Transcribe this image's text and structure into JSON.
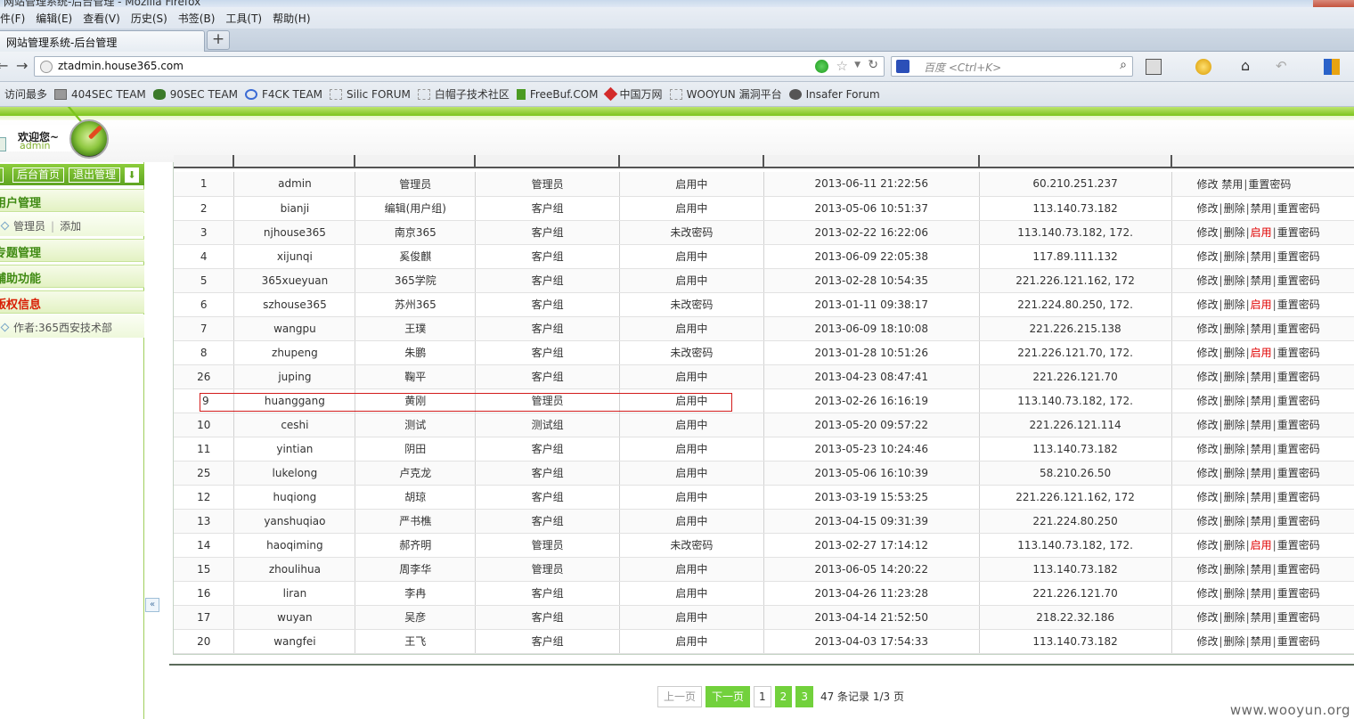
{
  "window": {
    "title": "网站管理系统-后台管理 - Mozilla Firefox",
    "colors": {
      "accent_green": "#72d13c",
      "header_green": "#7cc41d",
      "alert_red": "#e00000",
      "highlight_red": "#d21b1b"
    }
  },
  "browser": {
    "menu": [
      "件(F)",
      "编辑(E)",
      "查看(V)",
      "历史(S)",
      "书签(B)",
      "工具(T)",
      "帮助(H)"
    ],
    "tab_title": "网站管理系统-后台管理",
    "new_tab": "+",
    "url": "ztadmin.house365.com",
    "search_placeholder": "百度 <Ctrl+K>",
    "bookmarks": [
      "访问最多",
      "404SEC TEAM",
      "90SEC TEAM",
      "F4CK TEAM",
      "Silic FORUM",
      "白帽子技术社区",
      "FreeBuf.COM",
      "中国万网",
      "WOOYUN 漏洞平台",
      "Insafer Forum"
    ]
  },
  "header": {
    "welcome": "欢迎您~",
    "username": "admin"
  },
  "sidebar": {
    "home_btn": "后台首页",
    "logout_btn": "退出管理",
    "sections": {
      "user_mgmt": "用户管理",
      "admin_link": "管理员",
      "add_link": "添加",
      "topic_mgmt": "专题管理",
      "aux": "辅助功能",
      "copyright": "版权信息",
      "author": "作者:365西安技术部"
    },
    "collapse": "«"
  },
  "table": {
    "ops": {
      "edit": "修改",
      "delete": "删除",
      "disable": "禁用",
      "enable": "启用",
      "reset": "重置密码"
    },
    "rows": [
      {
        "id": "1",
        "user": "admin",
        "name": "管理员",
        "type": "管理员",
        "status": "启用中",
        "time": "2013-06-11 21:22:56",
        "ip": "60.210.251.237",
        "mode": "admin"
      },
      {
        "id": "2",
        "user": "bianji",
        "name": "编辑(用户组)",
        "type": "客户组",
        "status": "启用中",
        "time": "2013-05-06 10:51:37",
        "ip": "113.140.73.182",
        "mode": "disable"
      },
      {
        "id": "3",
        "user": "njhouse365",
        "name": "南京365",
        "type": "客户组",
        "status": "未改密码",
        "time": "2013-02-22 16:22:06",
        "ip": "113.140.73.182, 172.",
        "mode": "enable"
      },
      {
        "id": "4",
        "user": "xijunqi",
        "name": "奚俊麒",
        "type": "客户组",
        "status": "启用中",
        "time": "2013-06-09 22:05:38",
        "ip": "117.89.111.132",
        "mode": "disable"
      },
      {
        "id": "5",
        "user": "365xueyuan",
        "name": "365学院",
        "type": "客户组",
        "status": "启用中",
        "time": "2013-02-28 10:54:35",
        "ip": "221.226.121.162, 172",
        "mode": "disable"
      },
      {
        "id": "6",
        "user": "szhouse365",
        "name": "苏州365",
        "type": "客户组",
        "status": "未改密码",
        "time": "2013-01-11 09:38:17",
        "ip": "221.224.80.250, 172.",
        "mode": "enable"
      },
      {
        "id": "7",
        "user": "wangpu",
        "name": "王璞",
        "type": "客户组",
        "status": "启用中",
        "time": "2013-06-09 18:10:08",
        "ip": "221.226.215.138",
        "mode": "disable"
      },
      {
        "id": "8",
        "user": "zhupeng",
        "name": "朱鹏",
        "type": "客户组",
        "status": "未改密码",
        "time": "2013-01-28 10:51:26",
        "ip": "221.226.121.70, 172.",
        "mode": "enable"
      },
      {
        "id": "26",
        "user": "juping",
        "name": "鞠平",
        "type": "客户组",
        "status": "启用中",
        "time": "2013-04-23 08:47:41",
        "ip": "221.226.121.70",
        "mode": "disable"
      },
      {
        "id": "9",
        "user": "huanggang",
        "name": "黄刚",
        "type": "管理员",
        "status": "启用中",
        "time": "2013-02-26 16:16:19",
        "ip": "113.140.73.182, 172.",
        "mode": "disable"
      },
      {
        "id": "10",
        "user": "ceshi",
        "name": "测试",
        "type": "测试组",
        "status": "启用中",
        "time": "2013-05-20 09:57:22",
        "ip": "221.226.121.114",
        "mode": "disable"
      },
      {
        "id": "11",
        "user": "yintian",
        "name": "阴田",
        "type": "客户组",
        "status": "启用中",
        "time": "2013-05-23 10:24:46",
        "ip": "113.140.73.182",
        "mode": "disable"
      },
      {
        "id": "25",
        "user": "lukelong",
        "name": "卢克龙",
        "type": "客户组",
        "status": "启用中",
        "time": "2013-05-06 16:10:39",
        "ip": "58.210.26.50",
        "mode": "disable"
      },
      {
        "id": "12",
        "user": "huqiong",
        "name": "胡琼",
        "type": "客户组",
        "status": "启用中",
        "time": "2013-03-19 15:53:25",
        "ip": "221.226.121.162, 172",
        "mode": "disable"
      },
      {
        "id": "13",
        "user": "yanshuqiao",
        "name": "严书樵",
        "type": "客户组",
        "status": "启用中",
        "time": "2013-04-15 09:31:39",
        "ip": "221.224.80.250",
        "mode": "disable"
      },
      {
        "id": "14",
        "user": "haoqiming",
        "name": "郝齐明",
        "type": "管理员",
        "status": "未改密码",
        "time": "2013-02-27 17:14:12",
        "ip": "113.140.73.182, 172.",
        "mode": "enable"
      },
      {
        "id": "15",
        "user": "zhoulihua",
        "name": "周李华",
        "type": "管理员",
        "status": "启用中",
        "time": "2013-06-05 14:20:22",
        "ip": "113.140.73.182",
        "mode": "disable"
      },
      {
        "id": "16",
        "user": "liran",
        "name": "李冉",
        "type": "客户组",
        "status": "启用中",
        "time": "2013-04-26 11:23:28",
        "ip": "221.226.121.70",
        "mode": "disable"
      },
      {
        "id": "17",
        "user": "wuyan",
        "name": "吴彦",
        "type": "客户组",
        "status": "启用中",
        "time": "2013-04-14 21:52:50",
        "ip": "218.22.32.186",
        "mode": "disable"
      },
      {
        "id": "20",
        "user": "wangfei",
        "name": "王飞",
        "type": "客户组",
        "status": "启用中",
        "time": "2013-04-03 17:54:33",
        "ip": "113.140.73.182",
        "mode": "disable"
      }
    ]
  },
  "pager": {
    "prev": "上一页",
    "next": "下一页",
    "pages": [
      "1",
      "2",
      "3"
    ],
    "info": "47 条记录 1/3 页"
  },
  "watermark": "www.wooyun.org"
}
